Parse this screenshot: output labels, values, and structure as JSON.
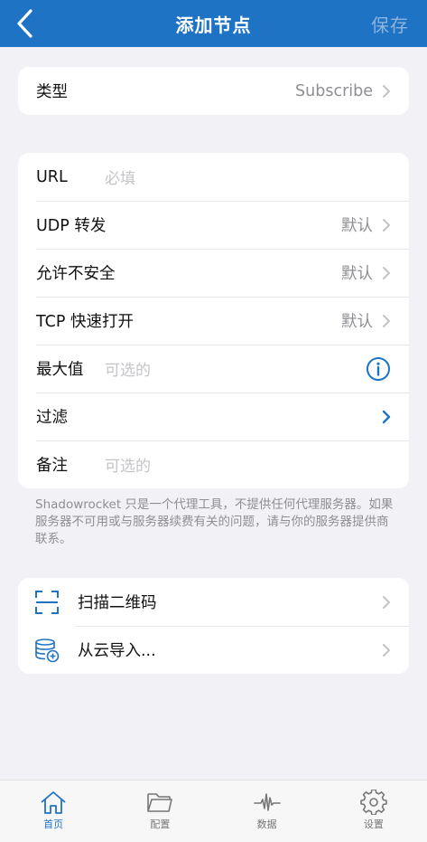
{
  "colors": {
    "accent": "#1f73c4",
    "background": "#f2f2f6",
    "muted": "#8e8e93",
    "placeholder": "#c4c4c8"
  },
  "navbar": {
    "title": "添加节点",
    "save_label": "保存",
    "back_icon": "chevron-left-icon"
  },
  "type_row": {
    "label": "类型",
    "value": "Subscribe"
  },
  "form": {
    "url": {
      "label": "URL",
      "placeholder": "必填"
    },
    "udp": {
      "label": "UDP 转发",
      "value": "默认"
    },
    "insecure": {
      "label": "允许不安全",
      "value": "默认"
    },
    "tcp_fast_open": {
      "label": "TCP 快速打开",
      "value": "默认"
    },
    "max": {
      "label": "最大值",
      "placeholder": "可选的",
      "icon": "info-icon"
    },
    "filter": {
      "label": "过滤"
    },
    "remark": {
      "label": "备注",
      "placeholder": "可选的"
    }
  },
  "note": "Shadowrocket 只是一个代理工具，不提供任何代理服务器。如果服务器不可用或与服务器续费有关的问题，请与你的服务器提供商联系。",
  "actions": [
    {
      "label": "扫描二维码",
      "icon": "qr-scan-icon"
    },
    {
      "label": "从云导入...",
      "icon": "cloud-database-import-icon"
    }
  ],
  "tabbar": [
    {
      "label": "首页",
      "icon": "home-icon",
      "active": true
    },
    {
      "label": "配置",
      "icon": "folder-icon",
      "active": false
    },
    {
      "label": "数据",
      "icon": "pulse-icon",
      "active": false
    },
    {
      "label": "设置",
      "icon": "gear-icon",
      "active": false
    }
  ]
}
